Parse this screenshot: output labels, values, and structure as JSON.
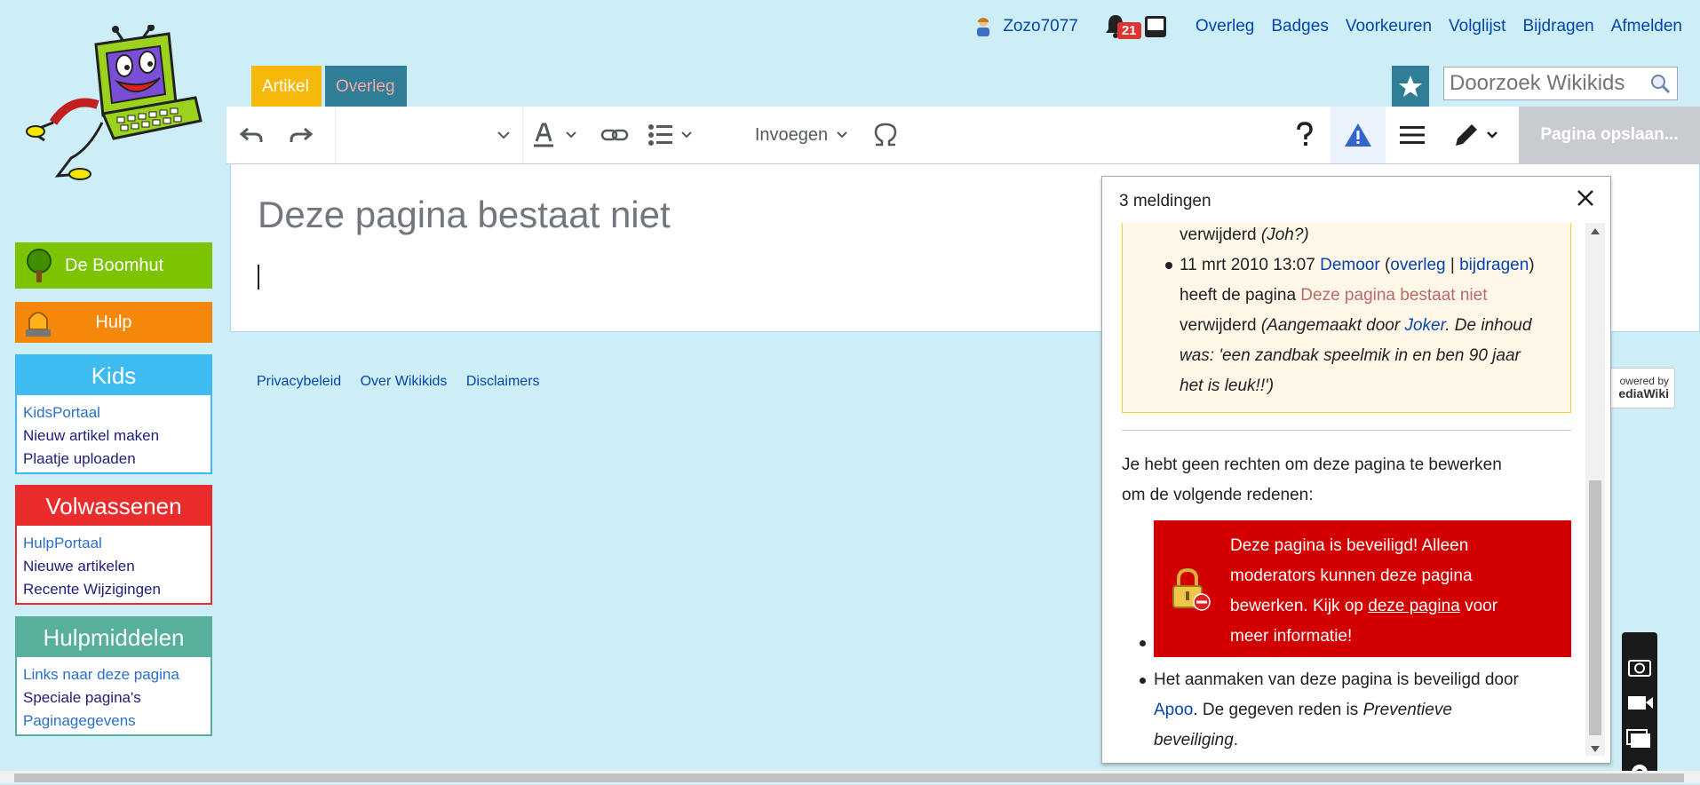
{
  "personal": {
    "username": "Zozo7077",
    "notifications_count": "21",
    "links": [
      "Overleg",
      "Badges",
      "Voorkeuren",
      "Volglijst",
      "Bijdragen",
      "Afmelden"
    ]
  },
  "tabs": {
    "artikel": "Artikel",
    "overleg": "Overleg"
  },
  "search": {
    "placeholder": "Doorzoek Wikikids"
  },
  "sidebar": {
    "boomhut": "De Boomhut",
    "hulp": "Hulp",
    "kids": {
      "title": "Kids",
      "items": [
        "KidsPortaal",
        "Nieuw artikel maken",
        "Plaatje uploaden"
      ]
    },
    "volwassenen": {
      "title": "Volwassenen",
      "items": [
        "HulpPortaal",
        "Nieuwe artikelen",
        "Recente Wijzigingen"
      ]
    },
    "hulpmiddelen": {
      "title": "Hulpmiddelen",
      "items": [
        "Links naar deze pagina",
        "Speciale pagina's",
        "Paginagegevens"
      ]
    }
  },
  "toolbar": {
    "insert_label": "Invoegen",
    "save_label": "Pagina opslaan..."
  },
  "page": {
    "title": "Deze pagina bestaat niet"
  },
  "footer": {
    "links": [
      "Privacybeleid",
      "Over Wikikids",
      "Disclaimers"
    ],
    "powered_line1": "owered by",
    "powered_line2": "ediaWiki"
  },
  "popup": {
    "header": "3 meldingen",
    "log_line1_prefix": "verwijderd",
    "log_line1_reason": "(Joh?)",
    "log_date": "11 mrt 2010 13:07",
    "log_user": "Demoor",
    "log_overleg": "overleg",
    "log_bijdragen": "bijdragen",
    "log_text1": "heeft de pagina",
    "log_page": "Deze pagina bestaat niet",
    "log_text2": "verwijderd",
    "log_reason_a": "(Aangemaakt door",
    "log_reason_user": "Joker",
    "log_reason_b": ". De inhoud",
    "log_reason_c": "was: 'een zandbak speelmik in en ben 90 jaar",
    "log_reason_d": "het is leuk!!')",
    "rights_line1": "Je hebt geen rechten om deze pagina te bewerken",
    "rights_line2": "om de volgende redenen:",
    "protected_l1": "Deze pagina is beveiligd! Alleen",
    "protected_l2": "moderators kunnen deze pagina",
    "protected_l3a": "bewerken. Kijk op",
    "protected_link": "deze pagina",
    "protected_l3b": "voor",
    "protected_l4": "meer informatie!",
    "create_l1": "Het aanmaken van deze pagina is beveiligd door",
    "create_user": "Apoo",
    "create_l2": ". De gegeven reden is",
    "create_reason_a": "Preventieve",
    "create_reason_b": "beveiliging",
    "create_end": "."
  },
  "colors": {
    "background": "#cdeef6",
    "boomhut": "#7dc400",
    "hulp": "#f5870a",
    "kids": "#3ebcf2",
    "volwassenen": "#ea2c2c",
    "hulpmiddelen": "#57b09c",
    "tab_artikel": "#f5b80b",
    "tab_overleg": "#2f7d97",
    "protected_box": "#d20000"
  }
}
